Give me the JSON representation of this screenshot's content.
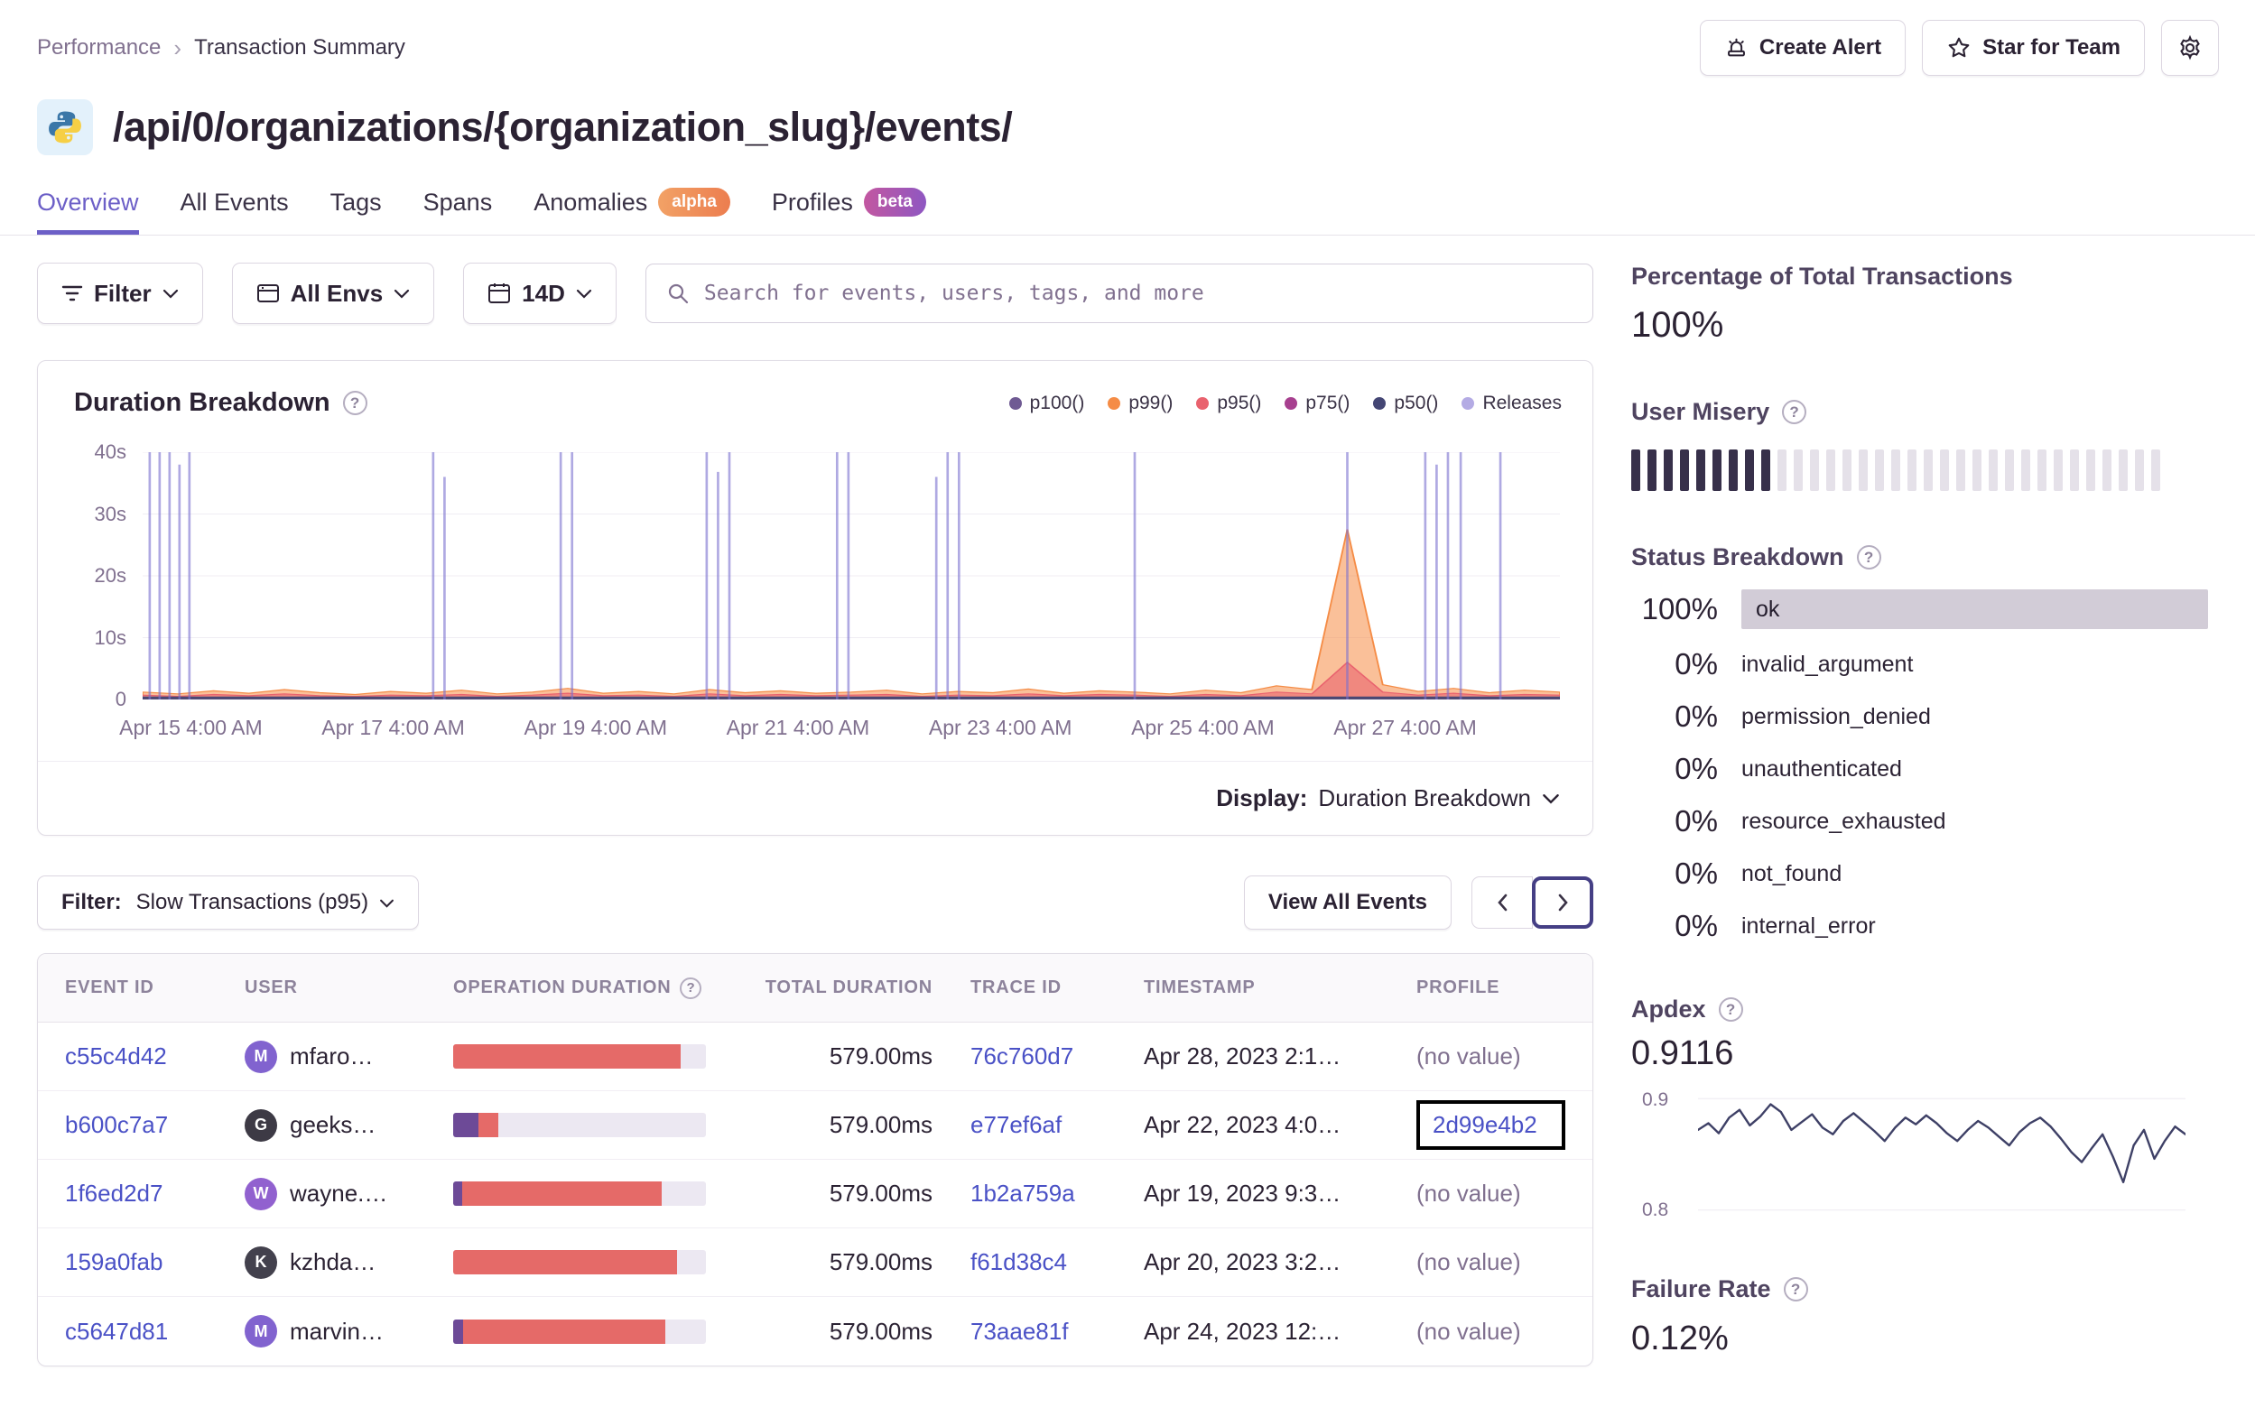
{
  "breadcrumb": {
    "items": [
      "Performance",
      "Transaction Summary"
    ],
    "separator": "›"
  },
  "actions": {
    "create_alert": "Create Alert",
    "star_for_team": "Star for Team"
  },
  "page": {
    "title": "/api/0/organizations/{organization_slug}/events/"
  },
  "tabs": [
    {
      "label": "Overview"
    },
    {
      "label": "All Events"
    },
    {
      "label": "Tags"
    },
    {
      "label": "Spans"
    },
    {
      "label": "Anomalies",
      "badge": "alpha"
    },
    {
      "label": "Profiles",
      "badge": "beta"
    }
  ],
  "filter_bar": {
    "filter": "Filter",
    "environment": "All Envs",
    "date_range": "14D",
    "search_placeholder": "Search for events, users, tags, and more"
  },
  "duration_chart": {
    "title": "Duration Breakdown",
    "legend": [
      {
        "label": "p100()",
        "color": "#6f5a93"
      },
      {
        "label": "p99()",
        "color": "#f58c46"
      },
      {
        "label": "p95()",
        "color": "#e9626e"
      },
      {
        "label": "p75()",
        "color": "#a7408f"
      },
      {
        "label": "p50()",
        "color": "#444674"
      },
      {
        "label": "Releases",
        "color": "#b4abe4"
      }
    ],
    "chart_data": {
      "type": "area",
      "ylabel_unit": "seconds",
      "ylim": [
        0,
        40
      ],
      "y_ticks": [
        "40s",
        "30s",
        "20s",
        "10s",
        "0"
      ],
      "x_ticks": [
        "Apr 15 4:00 AM",
        "Apr 17 4:00 AM",
        "Apr 19 4:00 AM",
        "Apr 21 4:00 AM",
        "Apr 23 4:00 AM",
        "Apr 25 4:00 AM",
        "Apr 27 4:00 AM"
      ],
      "series": [
        {
          "name": "p99()",
          "color": "#f58c46",
          "fill": "rgba(245,140,70,0.55)",
          "values": [
            1.2,
            0.9,
            1.4,
            1.0,
            1.6,
            1.1,
            0.8,
            1.3,
            1.0,
            1.5,
            0.9,
            1.2,
            1.8,
            1.0,
            1.3,
            0.9,
            1.6,
            1.1,
            1.4,
            1.0,
            1.2,
            1.5,
            0.9,
            1.3,
            1.1,
            1.7,
            1.0,
            1.4,
            1.2,
            0.9,
            1.5,
            1.1,
            2.2,
            1.6,
            27.5,
            2.4,
            1.3,
            1.8,
            1.1,
            1.5,
            1.2
          ]
        },
        {
          "name": "p95()",
          "color": "#e9626e",
          "fill": "rgba(233,98,110,0.6)",
          "values": [
            0.7,
            0.5,
            0.8,
            0.6,
            0.9,
            0.6,
            0.5,
            0.7,
            0.6,
            0.8,
            0.5,
            0.7,
            1.0,
            0.6,
            0.7,
            0.5,
            0.9,
            0.6,
            0.8,
            0.6,
            0.7,
            0.8,
            0.5,
            0.7,
            0.6,
            0.9,
            0.6,
            0.8,
            0.7,
            0.5,
            0.8,
            0.6,
            1.2,
            0.9,
            6.0,
            1.2,
            0.7,
            1.0,
            0.6,
            0.8,
            0.7
          ]
        },
        {
          "name": "p50()",
          "color": "#444674",
          "fill": "rgba(68,70,116,0.9)",
          "values": [
            0.4,
            0.4,
            0.4,
            0.4,
            0.4,
            0.4,
            0.4,
            0.4,
            0.4,
            0.4,
            0.4,
            0.4,
            0.4,
            0.4,
            0.4,
            0.4,
            0.4,
            0.4,
            0.4,
            0.4,
            0.4,
            0.4,
            0.4,
            0.4,
            0.4,
            0.4,
            0.4,
            0.4,
            0.4,
            0.4,
            0.4,
            0.4,
            0.4,
            0.4,
            0.4,
            0.4,
            0.4,
            0.4,
            0.4,
            0.4,
            0.4
          ]
        }
      ],
      "releases": [
        [
          0.005,
          1
        ],
        [
          0.012,
          1
        ],
        [
          0.019,
          1
        ],
        [
          0.026,
          0.95
        ],
        [
          0.033,
          1
        ],
        [
          0.205,
          1
        ],
        [
          0.213,
          0.9
        ],
        [
          0.295,
          1
        ],
        [
          0.303,
          1
        ],
        [
          0.398,
          1
        ],
        [
          0.406,
          0.92
        ],
        [
          0.414,
          1
        ],
        [
          0.49,
          1
        ],
        [
          0.498,
          1
        ],
        [
          0.56,
          0.9
        ],
        [
          0.568,
          1
        ],
        [
          0.576,
          1
        ],
        [
          0.7,
          1
        ],
        [
          0.85,
          1
        ],
        [
          0.905,
          1
        ],
        [
          0.913,
          0.95
        ],
        [
          0.921,
          1
        ],
        [
          0.93,
          1
        ],
        [
          0.958,
          1
        ]
      ],
      "release_color": "#7b71cf"
    },
    "display": {
      "label": "Display:",
      "value": "Duration Breakdown"
    }
  },
  "events": {
    "filter_label": "Filter:",
    "filter_value": "Slow Transactions (p95)",
    "view_all": "View All Events",
    "columns": [
      "Event ID",
      "User",
      "Operation Duration",
      "Total Duration",
      "Trace ID",
      "Timestamp",
      "Profile"
    ],
    "rows": [
      {
        "event_id": "c55c4d42",
        "user_initial": "M",
        "user_name": "mfaro…",
        "avatar_color": "#8163cf",
        "bar_purple": 0,
        "bar_red": 0.9,
        "total": "579.00ms",
        "trace_id": "76c760d7",
        "timestamp": "Apr 28, 2023 2:1…",
        "profile": "(no value)"
      },
      {
        "event_id": "b600c7a7",
        "user_initial": "G",
        "user_name": "geeks…",
        "avatar_color": "#3d3a45",
        "bar_purple": 0.1,
        "bar_red": 0.08,
        "total": "579.00ms",
        "trace_id": "e77ef6af",
        "timestamp": "Apr 22, 2023 4:0…",
        "profile": "2d99e4b2"
      },
      {
        "event_id": "1f6ed2d7",
        "user_initial": "W",
        "user_name": "wayne.…",
        "avatar_color": "#9161cf",
        "bar_purple": 0.035,
        "bar_red": 0.79,
        "total": "579.00ms",
        "trace_id": "1b2a759a",
        "timestamp": "Apr 19, 2023 9:3…",
        "profile": "(no value)"
      },
      {
        "event_id": "159a0fab",
        "user_initial": "K",
        "user_name": "kzhda…",
        "avatar_color": "#43414d",
        "bar_purple": 0,
        "bar_red": 0.885,
        "total": "579.00ms",
        "trace_id": "f61d38c4",
        "timestamp": "Apr 20, 2023 3:2…",
        "profile": "(no value)"
      },
      {
        "event_id": "c5647d81",
        "user_initial": "M",
        "user_name": "marvin…",
        "avatar_color": "#8163cf",
        "bar_purple": 0.04,
        "bar_red": 0.8,
        "total": "579.00ms",
        "trace_id": "73aae81f",
        "timestamp": "Apr 24, 2023 12:…",
        "profile": "(no value)"
      }
    ]
  },
  "sidebar": {
    "percent_total": {
      "title": "Percentage of Total Transactions",
      "value": "100%"
    },
    "user_misery": {
      "title": "User Misery",
      "dark_bars": 9,
      "total_bars": 33
    },
    "status_breakdown": {
      "title": "Status Breakdown",
      "items": [
        {
          "pct": "100%",
          "label": "ok",
          "highlighted": true
        },
        {
          "pct": "0%",
          "label": "invalid_argument"
        },
        {
          "pct": "0%",
          "label": "permission_denied"
        },
        {
          "pct": "0%",
          "label": "unauthenticated"
        },
        {
          "pct": "0%",
          "label": "resource_exhausted"
        },
        {
          "pct": "0%",
          "label": "not_found"
        },
        {
          "pct": "0%",
          "label": "internal_error"
        }
      ]
    },
    "apdex": {
      "title": "Apdex",
      "value": "0.9116",
      "chart_data": {
        "type": "line",
        "ylim": [
          0.79,
          0.91
        ],
        "y_ticks": [
          "0.9",
          "0.8"
        ],
        "color": "#3e4066",
        "values": [
          0.872,
          0.878,
          0.869,
          0.883,
          0.89,
          0.876,
          0.884,
          0.895,
          0.888,
          0.872,
          0.879,
          0.886,
          0.874,
          0.868,
          0.88,
          0.887,
          0.879,
          0.871,
          0.862,
          0.874,
          0.883,
          0.877,
          0.885,
          0.878,
          0.869,
          0.862,
          0.872,
          0.88,
          0.874,
          0.866,
          0.858,
          0.87,
          0.878,
          0.883,
          0.875,
          0.864,
          0.852,
          0.843,
          0.856,
          0.868,
          0.848,
          0.825,
          0.858,
          0.872,
          0.846,
          0.862,
          0.875,
          0.868
        ]
      }
    },
    "failure_rate": {
      "title": "Failure Rate",
      "value": "0.12%"
    }
  }
}
